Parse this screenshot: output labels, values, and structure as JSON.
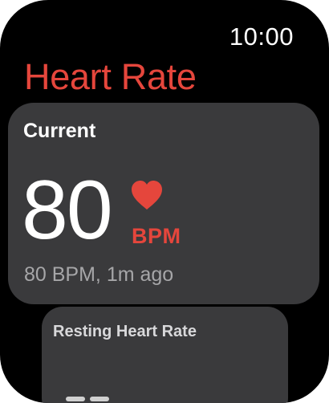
{
  "status_bar": {
    "time": "10:00"
  },
  "page": {
    "title": "Heart Rate",
    "accent_color": "#e5463c"
  },
  "current_card": {
    "title": "Current",
    "value": "80",
    "unit": "BPM",
    "icon": "heart-icon",
    "summary": "80 BPM, 1m ago"
  },
  "resting_card": {
    "title": "Resting Heart Rate"
  }
}
